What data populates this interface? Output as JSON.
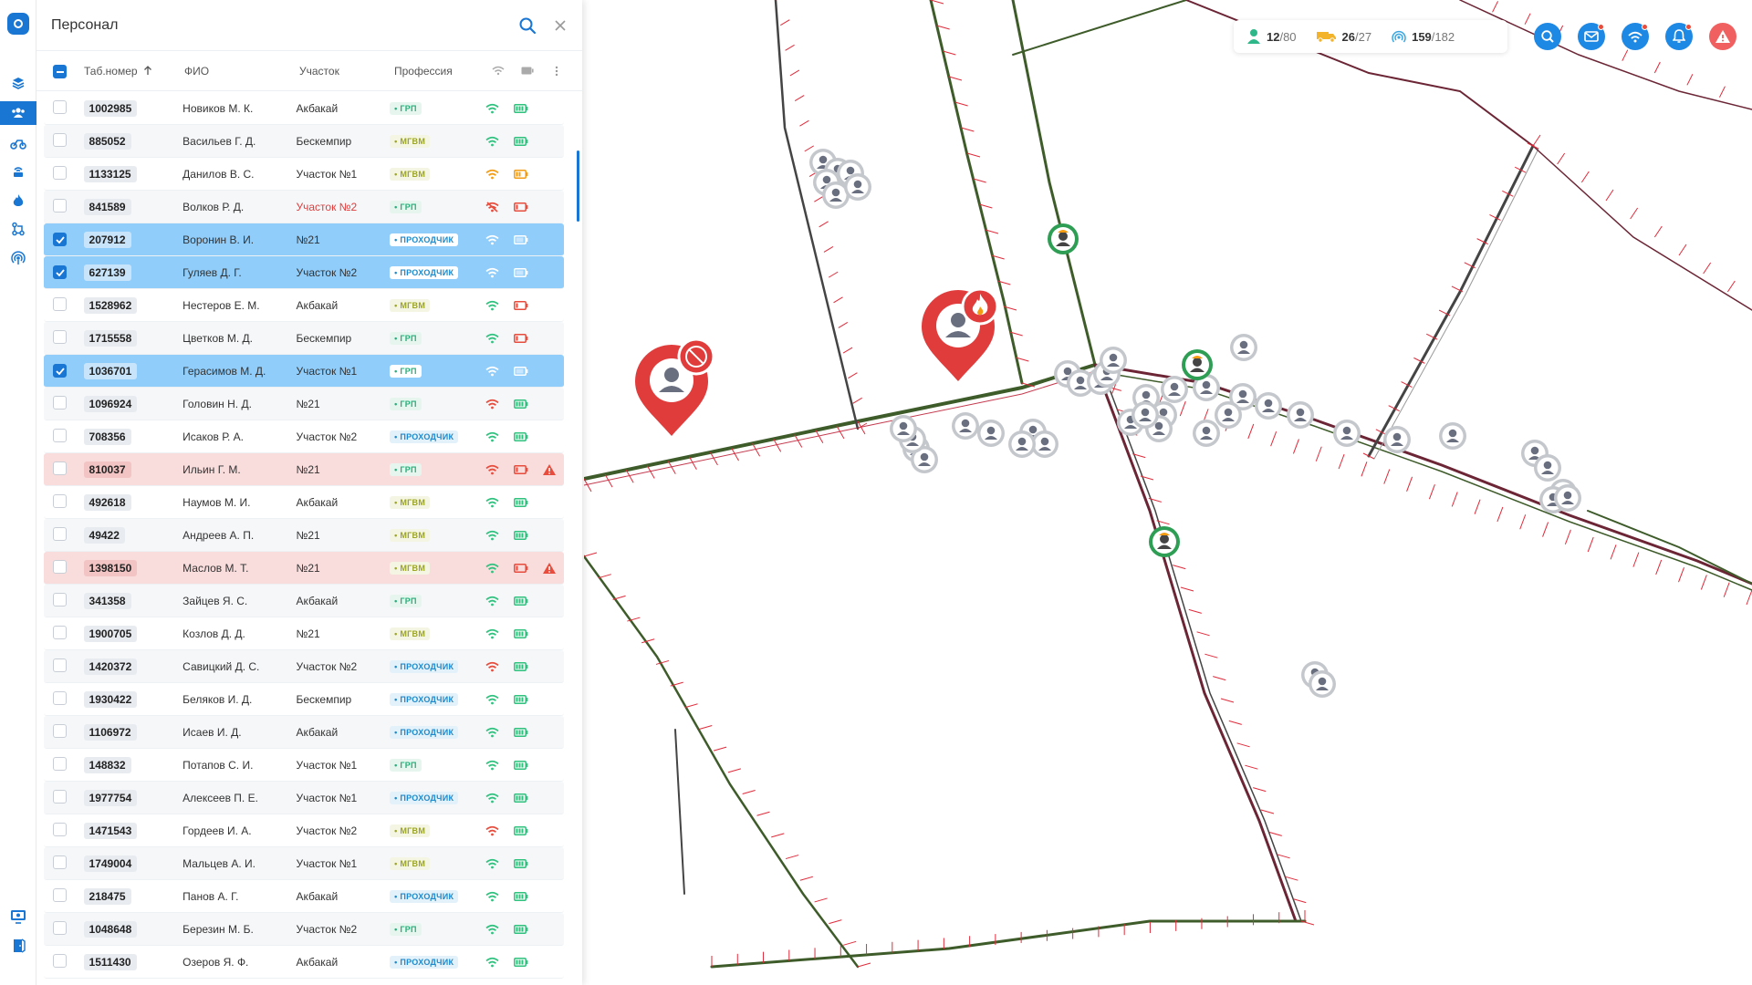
{
  "panel": {
    "title": "Персонал",
    "columns": {
      "tab": "Таб.номер",
      "fio": "ФИО",
      "area": "Участок",
      "prof": "Профессия"
    }
  },
  "stats": {
    "people": {
      "value": "12",
      "total": "/80"
    },
    "vehicles": {
      "value": "26",
      "total": "/27"
    },
    "beacons": {
      "value": "159",
      "total": "/182"
    }
  },
  "rows": [
    {
      "tab": "1002985",
      "fio": "Новиков М. К.",
      "area": "Акбакай",
      "prof": "ГРП",
      "wifi": "green",
      "bat": "green",
      "sel": false,
      "alarm": false
    },
    {
      "tab": "885052",
      "fio": "Васильев Г. Д.",
      "area": "Бескемпир",
      "prof": "МГВМ",
      "wifi": "green",
      "bat": "green",
      "sel": false,
      "alarm": false
    },
    {
      "tab": "1133125",
      "fio": "Данилов В. С.",
      "area": "Участок №1",
      "prof": "МГВМ",
      "wifi": "orange",
      "bat": "orange",
      "sel": false,
      "alarm": false
    },
    {
      "tab": "841589",
      "fio": "Волков Р. Д.",
      "area": "Участок №2",
      "prof": "ГРП",
      "wifi": "red-off",
      "bat": "red",
      "sel": false,
      "alarm": false,
      "area_red": true
    },
    {
      "tab": "207912",
      "fio": "Воронин В. И.",
      "area": "№21",
      "prof": "ПРОХОДЧИК",
      "wifi": "white",
      "bat": "white",
      "sel": true,
      "alarm": false
    },
    {
      "tab": "627139",
      "fio": "Гуляев Д. Г.",
      "area": "Участок №2",
      "prof": "ПРОХОДЧИК",
      "wifi": "white",
      "bat": "white",
      "sel": true,
      "alarm": false
    },
    {
      "tab": "1528962",
      "fio": "Нестеров Е. М.",
      "area": "Акбакай",
      "prof": "МГВМ",
      "wifi": "green",
      "bat": "red",
      "sel": false,
      "alarm": false
    },
    {
      "tab": "1715558",
      "fio": "Цветков М. Д.",
      "area": "Бескемпир",
      "prof": "ГРП",
      "wifi": "green",
      "bat": "red",
      "sel": false,
      "alarm": false
    },
    {
      "tab": "1036701",
      "fio": "Герасимов М. Д.",
      "area": "Участок №1",
      "prof": "ГРП",
      "wifi": "white",
      "bat": "white",
      "sel": true,
      "alarm": false
    },
    {
      "tab": "1096924",
      "fio": "Головин Н. Д.",
      "area": "№21",
      "prof": "ГРП",
      "wifi": "red",
      "bat": "green",
      "sel": false,
      "alarm": false
    },
    {
      "tab": "708356",
      "fio": "Исаков Р. А.",
      "area": "Участок №2",
      "prof": "ПРОХОДЧИК",
      "wifi": "green",
      "bat": "green",
      "sel": false,
      "alarm": false
    },
    {
      "tab": "810037",
      "fio": "Ильин Г. М.",
      "area": "№21",
      "prof": "ГРП",
      "wifi": "red",
      "bat": "red",
      "sel": false,
      "alarm": true
    },
    {
      "tab": "492618",
      "fio": "Наумов М. И.",
      "area": "Акбакай",
      "prof": "МГВМ",
      "wifi": "green",
      "bat": "green",
      "sel": false,
      "alarm": false
    },
    {
      "tab": "49422",
      "fio": "Андреев А. П.",
      "area": "№21",
      "prof": "МГВМ",
      "wifi": "green",
      "bat": "green",
      "sel": false,
      "alarm": false
    },
    {
      "tab": "1398150",
      "fio": "Маслов М. Т.",
      "area": "№21",
      "prof": "МГВМ",
      "wifi": "green",
      "bat": "red",
      "sel": false,
      "alarm": true
    },
    {
      "tab": "341358",
      "fio": "Зайцев Я. С.",
      "area": "Акбакай",
      "prof": "ГРП",
      "wifi": "green",
      "bat": "green",
      "sel": false,
      "alarm": false
    },
    {
      "tab": "1900705",
      "fio": "Козлов Д. Д.",
      "area": "№21",
      "prof": "МГВМ",
      "wifi": "green",
      "bat": "green",
      "sel": false,
      "alarm": false
    },
    {
      "tab": "1420372",
      "fio": "Савицкий Д. С.",
      "area": "Участок №2",
      "prof": "ПРОХОДЧИК",
      "wifi": "red",
      "bat": "green",
      "sel": false,
      "alarm": false
    },
    {
      "tab": "1930422",
      "fio": "Беляков И. Д.",
      "area": "Бескемпир",
      "prof": "ПРОХОДЧИК",
      "wifi": "green",
      "bat": "green",
      "sel": false,
      "alarm": false
    },
    {
      "tab": "1106972",
      "fio": "Исаев И. Д.",
      "area": "Акбакай",
      "prof": "ПРОХОДЧИК",
      "wifi": "green",
      "bat": "green",
      "sel": false,
      "alarm": false
    },
    {
      "tab": "148832",
      "fio": "Потапов С. И.",
      "area": "Участок №1",
      "prof": "ГРП",
      "wifi": "green",
      "bat": "green",
      "sel": false,
      "alarm": false
    },
    {
      "tab": "1977754",
      "fio": "Алексеев П. Е.",
      "area": "Участок №1",
      "prof": "ПРОХОДЧИК",
      "wifi": "green",
      "bat": "green",
      "sel": false,
      "alarm": false
    },
    {
      "tab": "1471543",
      "fio": "Гордеев И. А.",
      "area": "Участок №2",
      "prof": "МГВМ",
      "wifi": "red",
      "bat": "green",
      "sel": false,
      "alarm": false
    },
    {
      "tab": "1749004",
      "fio": "Мальцев А. И.",
      "area": "Участок №1",
      "prof": "МГВМ",
      "wifi": "green",
      "bat": "green",
      "sel": false,
      "alarm": false
    },
    {
      "tab": "218475",
      "fio": "Панов А. Г.",
      "area": "Акбакай",
      "prof": "ПРОХОДЧИК",
      "wifi": "green",
      "bat": "green",
      "sel": false,
      "alarm": false
    },
    {
      "tab": "1048648",
      "fio": "Березин М. Б.",
      "area": "Участок №2",
      "prof": "ГРП",
      "wifi": "green",
      "bat": "green",
      "sel": false,
      "alarm": false
    },
    {
      "tab": "1511430",
      "fio": "Озеров Я. Ф.",
      "area": "Акбакай",
      "prof": "ПРОХОДЧИК",
      "wifi": "green",
      "bat": "green",
      "sel": false,
      "alarm": false
    }
  ],
  "colors": {
    "accent": "#1976d2",
    "green": "#2ec27e",
    "orange": "#f39c12",
    "red": "#e74c3c",
    "tunnel": "#3e5b2a",
    "tunnel_dark": "#6b2535"
  },
  "icons": [
    "layers-icon",
    "people-icon",
    "vehicle-icon",
    "beacon-icon",
    "fire-icon",
    "route-icon",
    "antenna-icon",
    "monitor-icon",
    "exit-icon",
    "search-icon",
    "close-icon",
    "mail-icon",
    "wifi-icon",
    "bell-icon",
    "alert-icon"
  ]
}
